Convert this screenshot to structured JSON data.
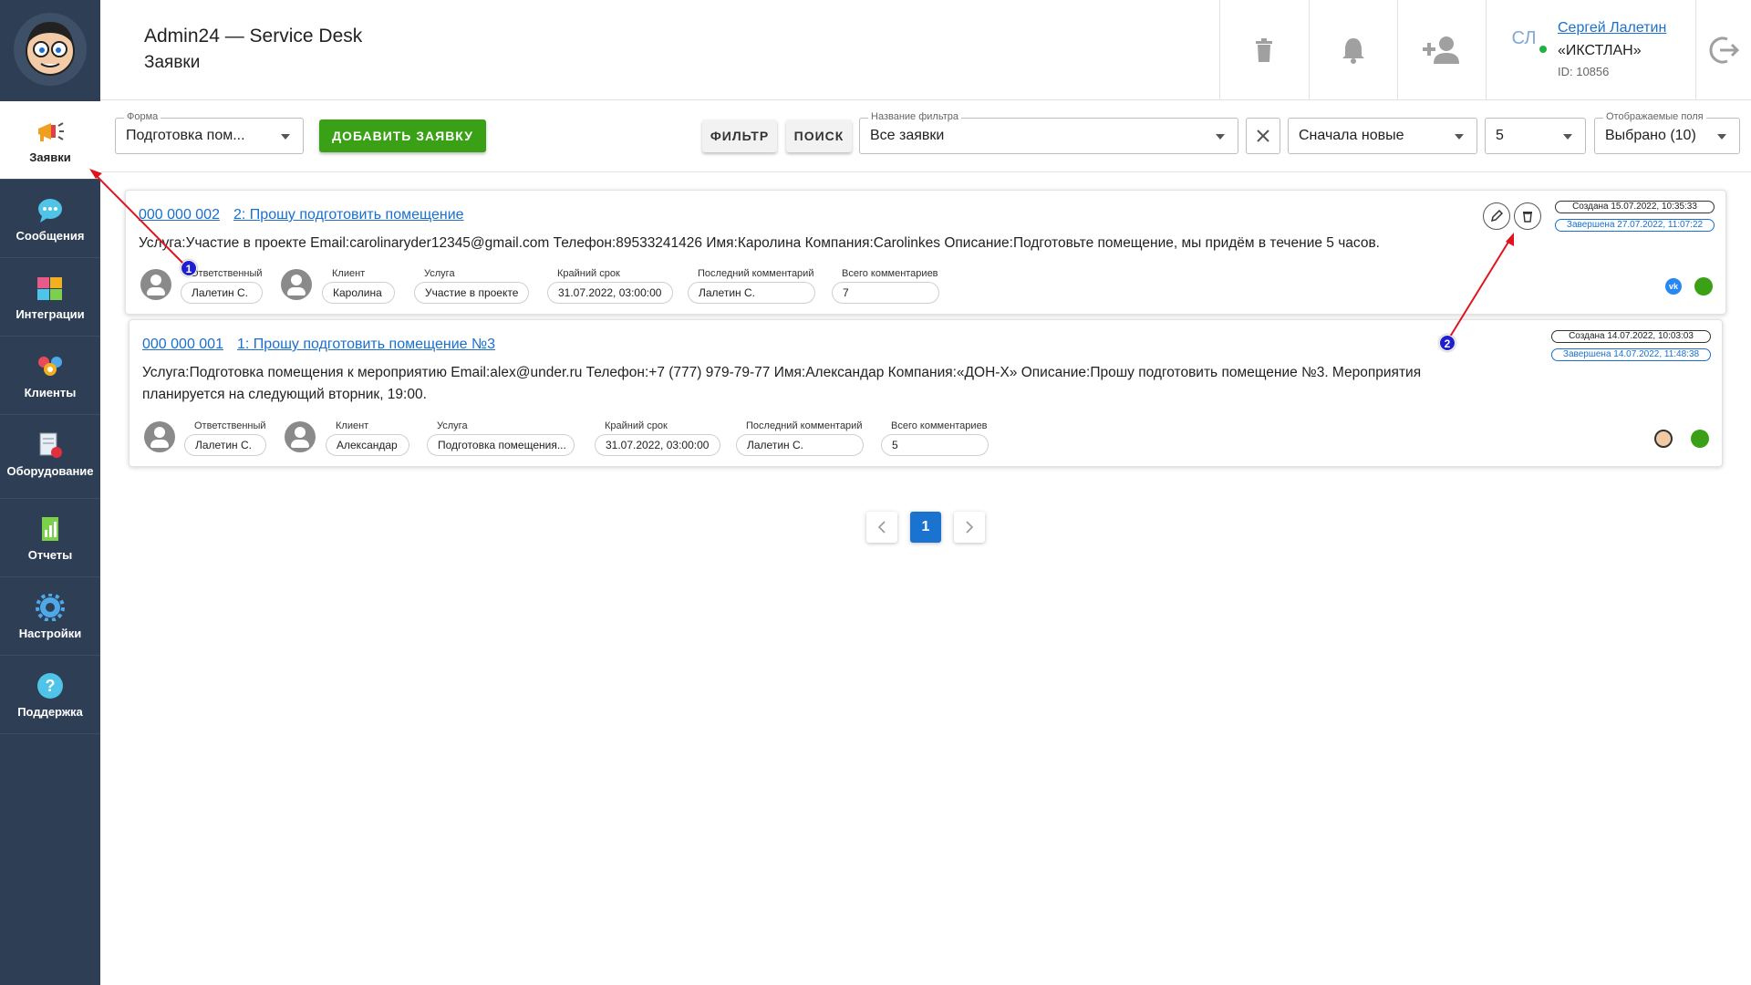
{
  "sidebar": {
    "items": [
      {
        "label": "Заявки",
        "icon": "megaphone-icon",
        "active": true
      },
      {
        "label": "Сообщения",
        "icon": "chat-icon"
      },
      {
        "label": "Интеграции",
        "icon": "puzzle-icon"
      },
      {
        "label": "Клиенты",
        "icon": "clients-icon"
      },
      {
        "label": "Оборудование",
        "icon": "equipment-icon"
      },
      {
        "label": "Отчеты",
        "icon": "report-icon"
      },
      {
        "label": "Настройки",
        "icon": "gear-icon"
      },
      {
        "label": "Поддержка",
        "icon": "help-icon"
      }
    ]
  },
  "header": {
    "app_title": "Admin24 — Service Desk",
    "page_title": "Заявки",
    "user": {
      "initials": "СЛ",
      "name": "Сергей Лалетин",
      "org": "«ИКСТЛАН»",
      "id": "ID: 10856"
    }
  },
  "toolbar": {
    "form_label": "Форма",
    "form_value": "Подготовка пом...",
    "add_button": "ДОБАВИТЬ ЗАЯВКУ",
    "filter_button": "ФИЛЬТР",
    "search_button": "ПОИСК",
    "filter_name_label": "Название фильтра",
    "filter_name_value": "Все заявки",
    "sort_value": "Сначала новые",
    "page_size_value": "5",
    "fields_label": "Отображаемые поля",
    "fields_value": "Выбрано (10)"
  },
  "tickets": [
    {
      "number": "000 000 002",
      "title": "2: Прошу подготовить помещение",
      "description": "Услуга:Участие в проекте Email:carolinaryder12345@gmail.com Телефон:89533241426 Имя:Каролина Компания:Carolinkes Описание:Подготовьте помещение, мы придём в течение 5 часов.",
      "meta": [
        {
          "label": "Ответственный",
          "value": "Лалетин С."
        },
        {
          "label": "Клиент",
          "value": "Каролина"
        },
        {
          "label": "Услуга",
          "value": "Участие в проекте"
        },
        {
          "label": "Крайний срок",
          "value": "31.07.2022, 03:00:00"
        },
        {
          "label": "Последний комментарий",
          "value": "Лалетин С."
        },
        {
          "label": "Всего комментариев",
          "value": "7"
        }
      ],
      "created": "Создана 15.07.2022, 10:35:33",
      "completed": "Завершена 27.07.2022, 11:07:22",
      "channel_icon": "vk-icon",
      "channel_text": "vk",
      "status_color": "#3aa016"
    },
    {
      "number": "000 000 001",
      "title": "1: Прошу подготовить помещение №3",
      "description": "Услуга:Подготовка помещения к мероприятию Email:alex@under.ru Телефон:+7 (777) 979-79-77 Имя:Александар Компания:«ДОН-Х» Описание:Прошу подготовить помещение №3. Мероприятия планируется на следующий вторник, 19:00.",
      "meta": [
        {
          "label": "Ответственный",
          "value": "Лалетин С."
        },
        {
          "label": "Клиент",
          "value": "Александар"
        },
        {
          "label": "Услуга",
          "value": "Подготовка помещения..."
        },
        {
          "label": "Крайний срок",
          "value": "31.07.2022, 03:00:00"
        },
        {
          "label": "Последний комментарий",
          "value": "Лалетин С."
        },
        {
          "label": "Всего комментариев",
          "value": "5"
        }
      ],
      "created": "Создана 14.07.2022, 10:03:03",
      "completed": "Завершена 14.07.2022, 11:48:38",
      "channel_icon": "face-icon",
      "status_color": "#3aa016"
    }
  ],
  "pagination": {
    "current": "1"
  },
  "annotations": [
    {
      "label": "1"
    },
    {
      "label": "2"
    }
  ],
  "colors": {
    "sidebar": "#2e3f55",
    "accent": "#3aa016",
    "link": "#1a6fcf",
    "annotation_arrow": "#e0141e"
  }
}
